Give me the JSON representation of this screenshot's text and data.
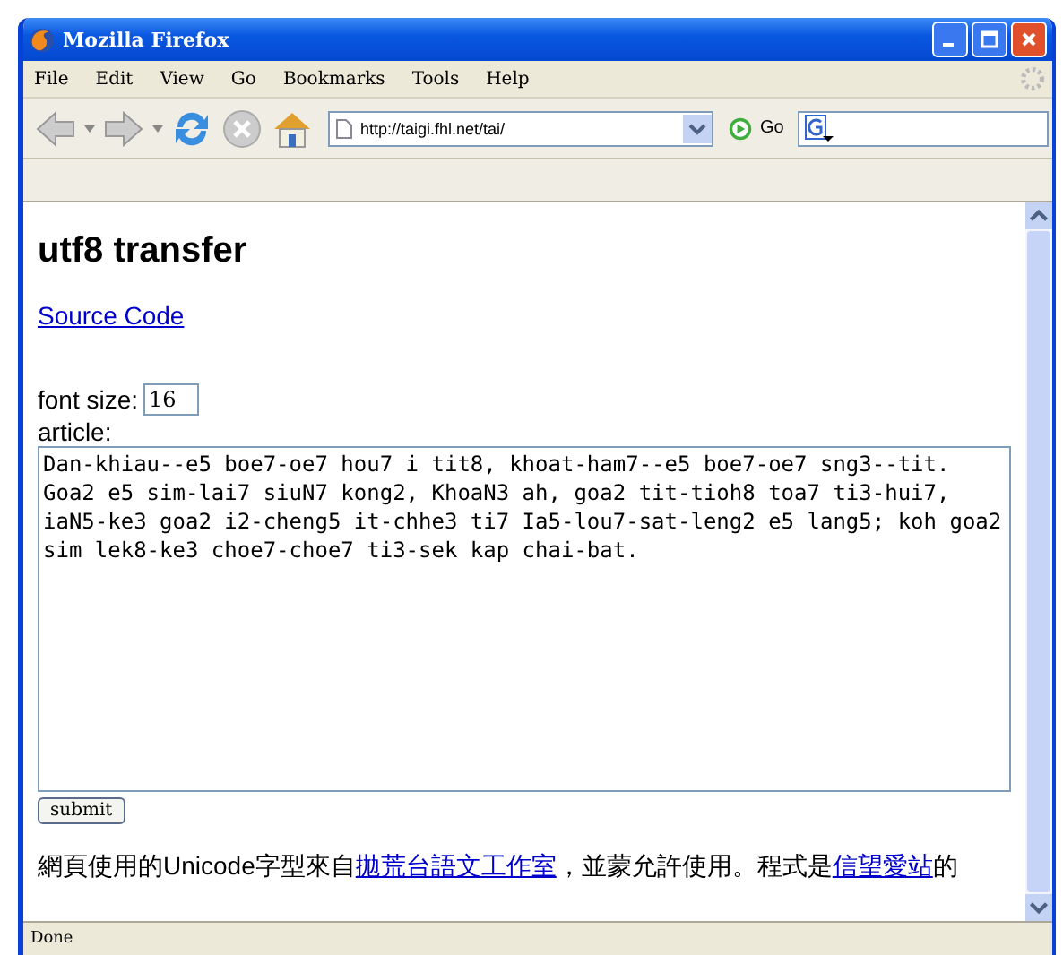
{
  "window": {
    "title": "Mozilla Firefox"
  },
  "menu": [
    "File",
    "Edit",
    "View",
    "Go",
    "Bookmarks",
    "Tools",
    "Help"
  ],
  "toolbar": {
    "url": "http://taigi.fhl.net/tai/",
    "go": "Go"
  },
  "page": {
    "heading": "utf8 transfer",
    "link": "Source Code",
    "font_size_label": "font size:",
    "font_size": "16",
    "article_label": "article:",
    "article": "Dan-khiau--e5 boe7-oe7 hou7 i tit8, khoat-ham7--e5 boe7-oe7 sng3--tit. Goa2 e5 sim-lai7 siuN7 kong2, KhoaN3 ah, goa2 tit-tioh8 toa7 ti3-hui7, iaN5-ke3 goa2 i2-cheng5 it-chhe3 ti7 Ia5-lou7-sat-leng2 e5 lang5; koh goa2 sim lek8-ke3 choe7-choe7 ti3-sek kap chai-bat.",
    "submit": "submit",
    "footer": [
      {
        "kind": "text",
        "text": "網頁使用的Unicode字型來自"
      },
      {
        "kind": "link",
        "text": "拋荒台語文工作室"
      },
      {
        "kind": "text",
        "text": "，並蒙允許使用。程式是"
      },
      {
        "kind": "link",
        "text": "信望愛站"
      },
      {
        "kind": "text",
        "text": "的"
      }
    ]
  },
  "status_bar": "Done"
}
